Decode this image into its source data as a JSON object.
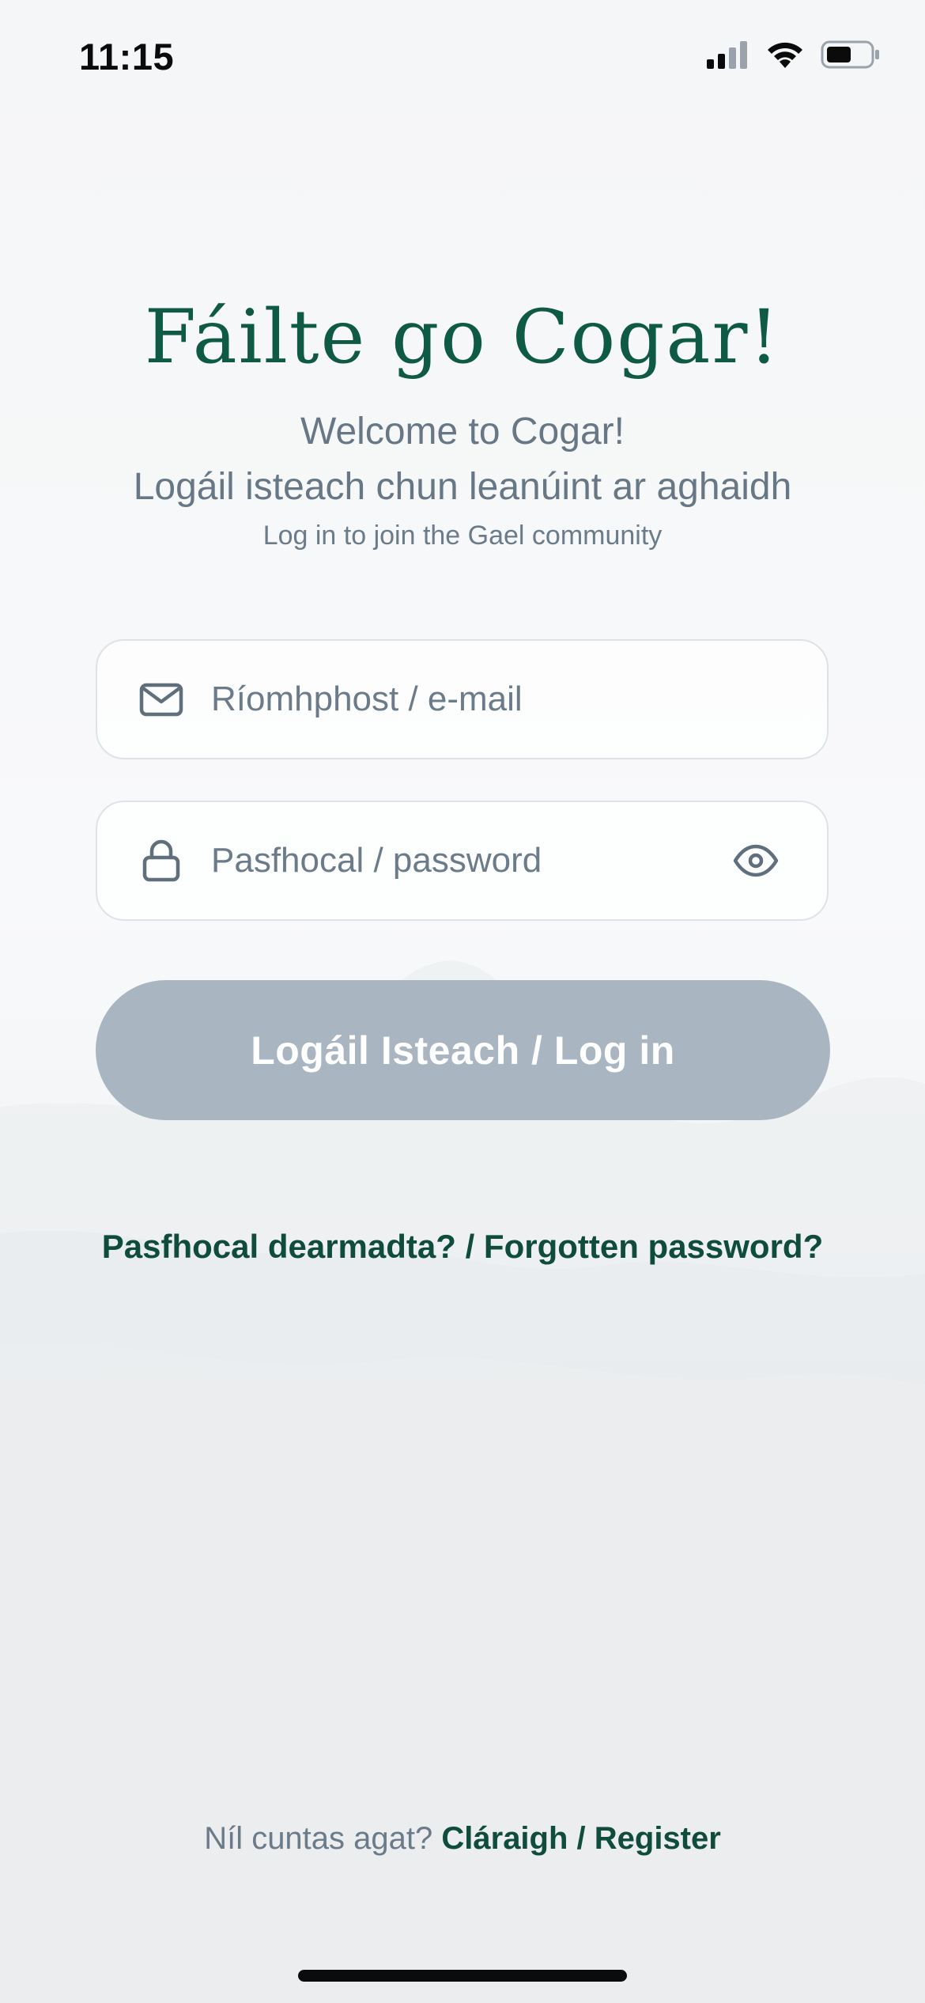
{
  "status_bar": {
    "time": "11:15"
  },
  "header": {
    "title": "Fáilte go Cogar!",
    "subtitle_en": "Welcome to Cogar!",
    "subtitle_ga": "Logáil isteach chun leanúint ar aghaidh",
    "subtitle_small": "Log in to join the Gael community"
  },
  "form": {
    "email": {
      "placeholder": "Ríomhphost / e-mail",
      "value": "",
      "icon": "mail-icon"
    },
    "password": {
      "placeholder": "Pasfhocal / password",
      "value": "",
      "icon": "lock-icon",
      "toggle_icon": "eye-icon"
    },
    "login_button": "Logáil Isteach / Log in",
    "forgot_link": "Pasfhocal dearmadta? / Forgotten password?"
  },
  "footer": {
    "no_account": "Níl cuntas agat?",
    "register_link": "Cláraigh / Register"
  },
  "colors": {
    "brand_green": "#0f5a44",
    "link_green": "#0f4c3b",
    "button_disabled": "#a9b5c0",
    "muted_text": "#677785"
  }
}
